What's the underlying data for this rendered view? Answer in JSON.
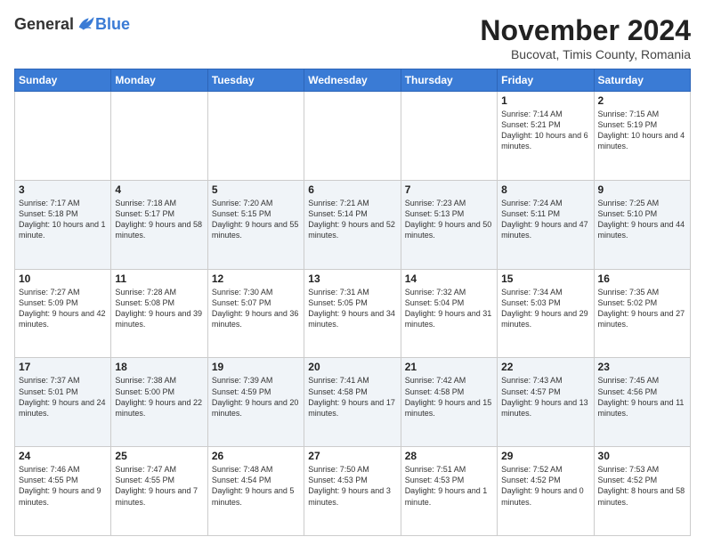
{
  "logo": {
    "general": "General",
    "blue": "Blue"
  },
  "header": {
    "month": "November 2024",
    "location": "Bucovat, Timis County, Romania"
  },
  "days_of_week": [
    "Sunday",
    "Monday",
    "Tuesday",
    "Wednesday",
    "Thursday",
    "Friday",
    "Saturday"
  ],
  "weeks": [
    [
      {
        "day": "",
        "info": ""
      },
      {
        "day": "",
        "info": ""
      },
      {
        "day": "",
        "info": ""
      },
      {
        "day": "",
        "info": ""
      },
      {
        "day": "",
        "info": ""
      },
      {
        "day": "1",
        "info": "Sunrise: 7:14 AM\nSunset: 5:21 PM\nDaylight: 10 hours and 6 minutes."
      },
      {
        "day": "2",
        "info": "Sunrise: 7:15 AM\nSunset: 5:19 PM\nDaylight: 10 hours and 4 minutes."
      }
    ],
    [
      {
        "day": "3",
        "info": "Sunrise: 7:17 AM\nSunset: 5:18 PM\nDaylight: 10 hours and 1 minute."
      },
      {
        "day": "4",
        "info": "Sunrise: 7:18 AM\nSunset: 5:17 PM\nDaylight: 9 hours and 58 minutes."
      },
      {
        "day": "5",
        "info": "Sunrise: 7:20 AM\nSunset: 5:15 PM\nDaylight: 9 hours and 55 minutes."
      },
      {
        "day": "6",
        "info": "Sunrise: 7:21 AM\nSunset: 5:14 PM\nDaylight: 9 hours and 52 minutes."
      },
      {
        "day": "7",
        "info": "Sunrise: 7:23 AM\nSunset: 5:13 PM\nDaylight: 9 hours and 50 minutes."
      },
      {
        "day": "8",
        "info": "Sunrise: 7:24 AM\nSunset: 5:11 PM\nDaylight: 9 hours and 47 minutes."
      },
      {
        "day": "9",
        "info": "Sunrise: 7:25 AM\nSunset: 5:10 PM\nDaylight: 9 hours and 44 minutes."
      }
    ],
    [
      {
        "day": "10",
        "info": "Sunrise: 7:27 AM\nSunset: 5:09 PM\nDaylight: 9 hours and 42 minutes."
      },
      {
        "day": "11",
        "info": "Sunrise: 7:28 AM\nSunset: 5:08 PM\nDaylight: 9 hours and 39 minutes."
      },
      {
        "day": "12",
        "info": "Sunrise: 7:30 AM\nSunset: 5:07 PM\nDaylight: 9 hours and 36 minutes."
      },
      {
        "day": "13",
        "info": "Sunrise: 7:31 AM\nSunset: 5:05 PM\nDaylight: 9 hours and 34 minutes."
      },
      {
        "day": "14",
        "info": "Sunrise: 7:32 AM\nSunset: 5:04 PM\nDaylight: 9 hours and 31 minutes."
      },
      {
        "day": "15",
        "info": "Sunrise: 7:34 AM\nSunset: 5:03 PM\nDaylight: 9 hours and 29 minutes."
      },
      {
        "day": "16",
        "info": "Sunrise: 7:35 AM\nSunset: 5:02 PM\nDaylight: 9 hours and 27 minutes."
      }
    ],
    [
      {
        "day": "17",
        "info": "Sunrise: 7:37 AM\nSunset: 5:01 PM\nDaylight: 9 hours and 24 minutes."
      },
      {
        "day": "18",
        "info": "Sunrise: 7:38 AM\nSunset: 5:00 PM\nDaylight: 9 hours and 22 minutes."
      },
      {
        "day": "19",
        "info": "Sunrise: 7:39 AM\nSunset: 4:59 PM\nDaylight: 9 hours and 20 minutes."
      },
      {
        "day": "20",
        "info": "Sunrise: 7:41 AM\nSunset: 4:58 PM\nDaylight: 9 hours and 17 minutes."
      },
      {
        "day": "21",
        "info": "Sunrise: 7:42 AM\nSunset: 4:58 PM\nDaylight: 9 hours and 15 minutes."
      },
      {
        "day": "22",
        "info": "Sunrise: 7:43 AM\nSunset: 4:57 PM\nDaylight: 9 hours and 13 minutes."
      },
      {
        "day": "23",
        "info": "Sunrise: 7:45 AM\nSunset: 4:56 PM\nDaylight: 9 hours and 11 minutes."
      }
    ],
    [
      {
        "day": "24",
        "info": "Sunrise: 7:46 AM\nSunset: 4:55 PM\nDaylight: 9 hours and 9 minutes."
      },
      {
        "day": "25",
        "info": "Sunrise: 7:47 AM\nSunset: 4:55 PM\nDaylight: 9 hours and 7 minutes."
      },
      {
        "day": "26",
        "info": "Sunrise: 7:48 AM\nSunset: 4:54 PM\nDaylight: 9 hours and 5 minutes."
      },
      {
        "day": "27",
        "info": "Sunrise: 7:50 AM\nSunset: 4:53 PM\nDaylight: 9 hours and 3 minutes."
      },
      {
        "day": "28",
        "info": "Sunrise: 7:51 AM\nSunset: 4:53 PM\nDaylight: 9 hours and 1 minute."
      },
      {
        "day": "29",
        "info": "Sunrise: 7:52 AM\nSunset: 4:52 PM\nDaylight: 9 hours and 0 minutes."
      },
      {
        "day": "30",
        "info": "Sunrise: 7:53 AM\nSunset: 4:52 PM\nDaylight: 8 hours and 58 minutes."
      }
    ]
  ]
}
